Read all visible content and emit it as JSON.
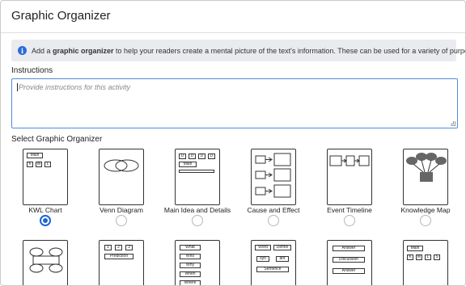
{
  "header": {
    "title": "Graphic Organizer"
  },
  "info": {
    "prefix": "Add a ",
    "bold": "graphic organizer",
    "suffix": " to help your readers create a mental picture of the text's information. These can be used for a variety of purposes."
  },
  "instructions": {
    "label": "Instructions",
    "placeholder": "Provide instructions for this activity"
  },
  "select": {
    "label": "Select Graphic Organizer",
    "selected": "KWL Chart",
    "options": [
      {
        "label": "KWL Chart"
      },
      {
        "label": "Venn Diagram"
      },
      {
        "label": "Main Idea and Details"
      },
      {
        "label": "Cause and Effect"
      },
      {
        "label": "Event Timeline"
      },
      {
        "label": "Knowledge Map"
      }
    ]
  },
  "thumbs": {
    "kwl": {
      "main": "Main",
      "k": "K",
      "w": "W",
      "l": "L"
    },
    "idea": {
      "d": "D",
      "main": "Main"
    },
    "r2": {
      "nums": [
        "1",
        "2",
        "3"
      ],
      "prediction": "Prediction",
      "five_w": [
        "What",
        "Who",
        "Why",
        "When",
        "Where"
      ],
      "vocab": {
        "word": "Word",
        "define": "Define",
        "syn": "syn",
        "ant": "ant",
        "sentence": "Sentence"
      },
      "qa": [
        "Answer",
        "Discussion",
        "Answer"
      ],
      "kwls": {
        "main": "Main",
        "letters": [
          "K",
          "W",
          "L",
          "S"
        ]
      }
    }
  }
}
